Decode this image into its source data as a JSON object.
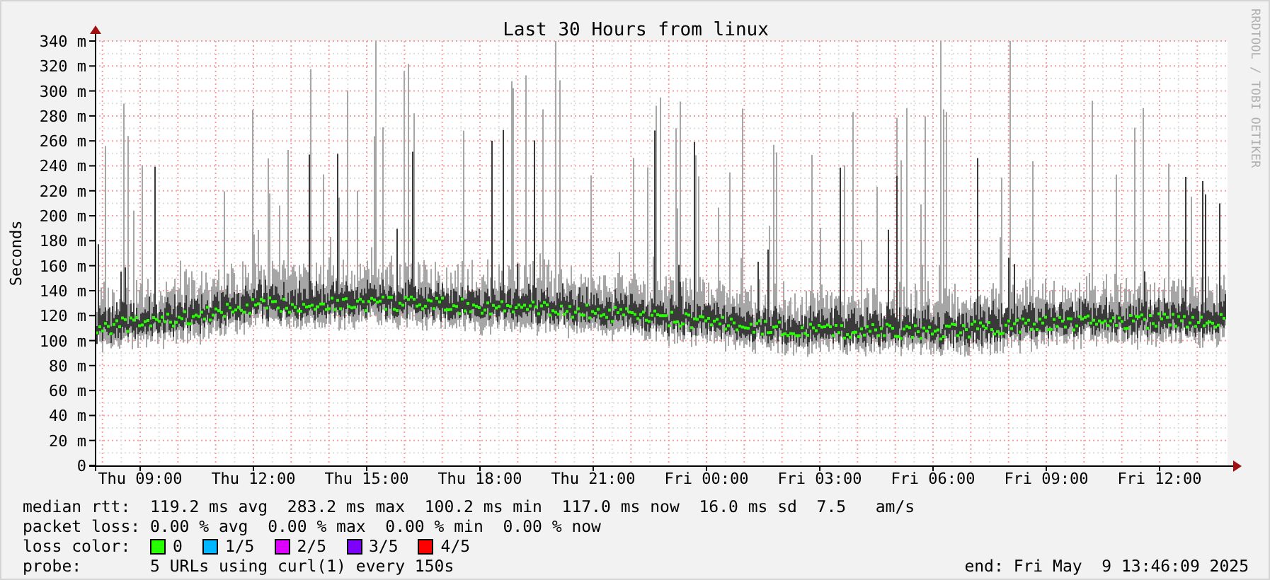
{
  "chart": {
    "title": "Last 30 Hours from linux",
    "ylabel": "Seconds",
    "credit": "RRDTOOL / TOBI OETIKER",
    "y_axis": [
      "340 m",
      "320 m",
      "300 m",
      "280 m",
      "260 m",
      "240 m",
      "220 m",
      "200 m",
      "180 m",
      "160 m",
      "140 m",
      "120 m",
      "100 m",
      "80 m",
      "60 m",
      "40 m",
      "20 m",
      "0"
    ],
    "x_axis": [
      "Thu 09:00",
      "Thu 12:00",
      "Thu 15:00",
      "Thu 18:00",
      "Thu 21:00",
      "Fri 00:00",
      "Fri 03:00",
      "Fri 06:00",
      "Fri 09:00",
      "Fri 12:00"
    ]
  },
  "legend": {
    "median_rtt": {
      "label": "median rtt:",
      "value": "119.2 ms avg  283.2 ms max  100.2 ms min  117.0 ms now  16.0 ms sd  7.5   am/s"
    },
    "packet_loss": {
      "label": "packet loss:",
      "value": "0.00 % avg  0.00 % max  0.00 % min  0.00 % now"
    },
    "loss_color": {
      "label": "loss color:",
      "items": [
        {
          "label": "0",
          "color": "#26ff00"
        },
        {
          "label": "1/5",
          "color": "#00b8ff"
        },
        {
          "label": "2/5",
          "color": "#dd00ff"
        },
        {
          "label": "3/5",
          "color": "#7e00ff"
        },
        {
          "label": "4/5",
          "color": "#ff0000"
        }
      ]
    },
    "probe": {
      "label": "probe:",
      "value": "5 URLs using curl(1) every 150s",
      "end": "end: Fri May  9 13:46:09 2025"
    }
  }
}
